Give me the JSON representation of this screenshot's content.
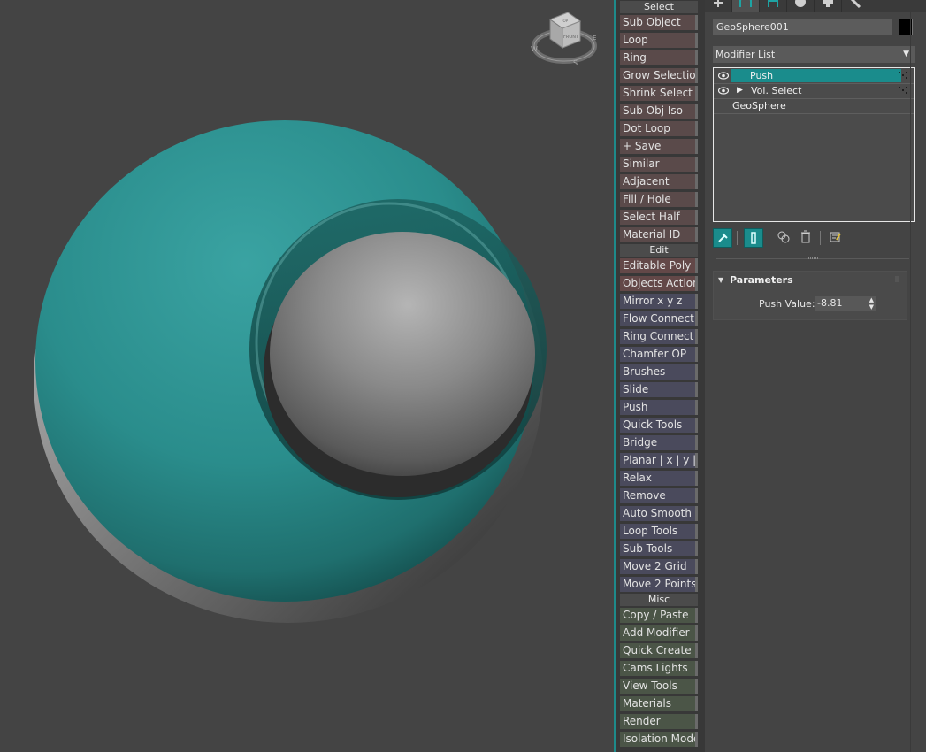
{
  "viewcube": {
    "top": "TOP",
    "front": "FRONT",
    "compass_w": "W",
    "compass_e": "E",
    "compass_s": "S"
  },
  "colors": {
    "accent": "#1a8c8c",
    "teal_sphere": "#2a8d8c",
    "gray_sphere": "#8a8a8a",
    "viewport_bg": "#444444"
  },
  "quad_menu": {
    "select": {
      "header": "Select",
      "items": [
        "Sub Object",
        "Loop",
        "Ring",
        "Grow Selection",
        "Shrink Select",
        "Sub Obj Iso",
        "Dot Loop",
        "+ Save",
        "Similar",
        "Adjacent",
        "Fill / Hole",
        "Select Half",
        "Material ID"
      ]
    },
    "edit": {
      "header": "Edit",
      "items": [
        "Editable Poly",
        "Objects Actions",
        "Mirror   x  y  z",
        "Flow Connect",
        "Ring Connect",
        "Chamfer OP",
        "Brushes",
        "Slide",
        "Push",
        "Quick Tools",
        "Bridge",
        "Planar | x | y | z",
        "Relax",
        "Remove",
        "Auto Smooth",
        "Loop Tools",
        "Sub Tools",
        "Move 2 Grid",
        "Move 2 Points"
      ]
    },
    "misc": {
      "header": "Misc",
      "items": [
        "Copy / Paste",
        "Add Modifier",
        "Quick Create",
        "Cams Lights",
        "View Tools",
        "Materials",
        "Render",
        "Isolation Mode"
      ]
    }
  },
  "command_panel": {
    "tabs": [
      "create-icon",
      "modify-icon",
      "hierarchy-icon",
      "motion-icon",
      "display-icon",
      "utilities-icon"
    ],
    "object_name": "GeoSphere001",
    "object_color": "#000000",
    "modifier_list": "Modifier List",
    "stack": [
      {
        "label": "Push",
        "selected": true
      },
      {
        "label": "Vol. Select",
        "selected": false
      },
      {
        "label": "GeoSphere",
        "selected": false
      }
    ],
    "parameters": {
      "title": "Parameters",
      "push_value_label": "Push Value:",
      "push_value": "-8.81"
    }
  }
}
